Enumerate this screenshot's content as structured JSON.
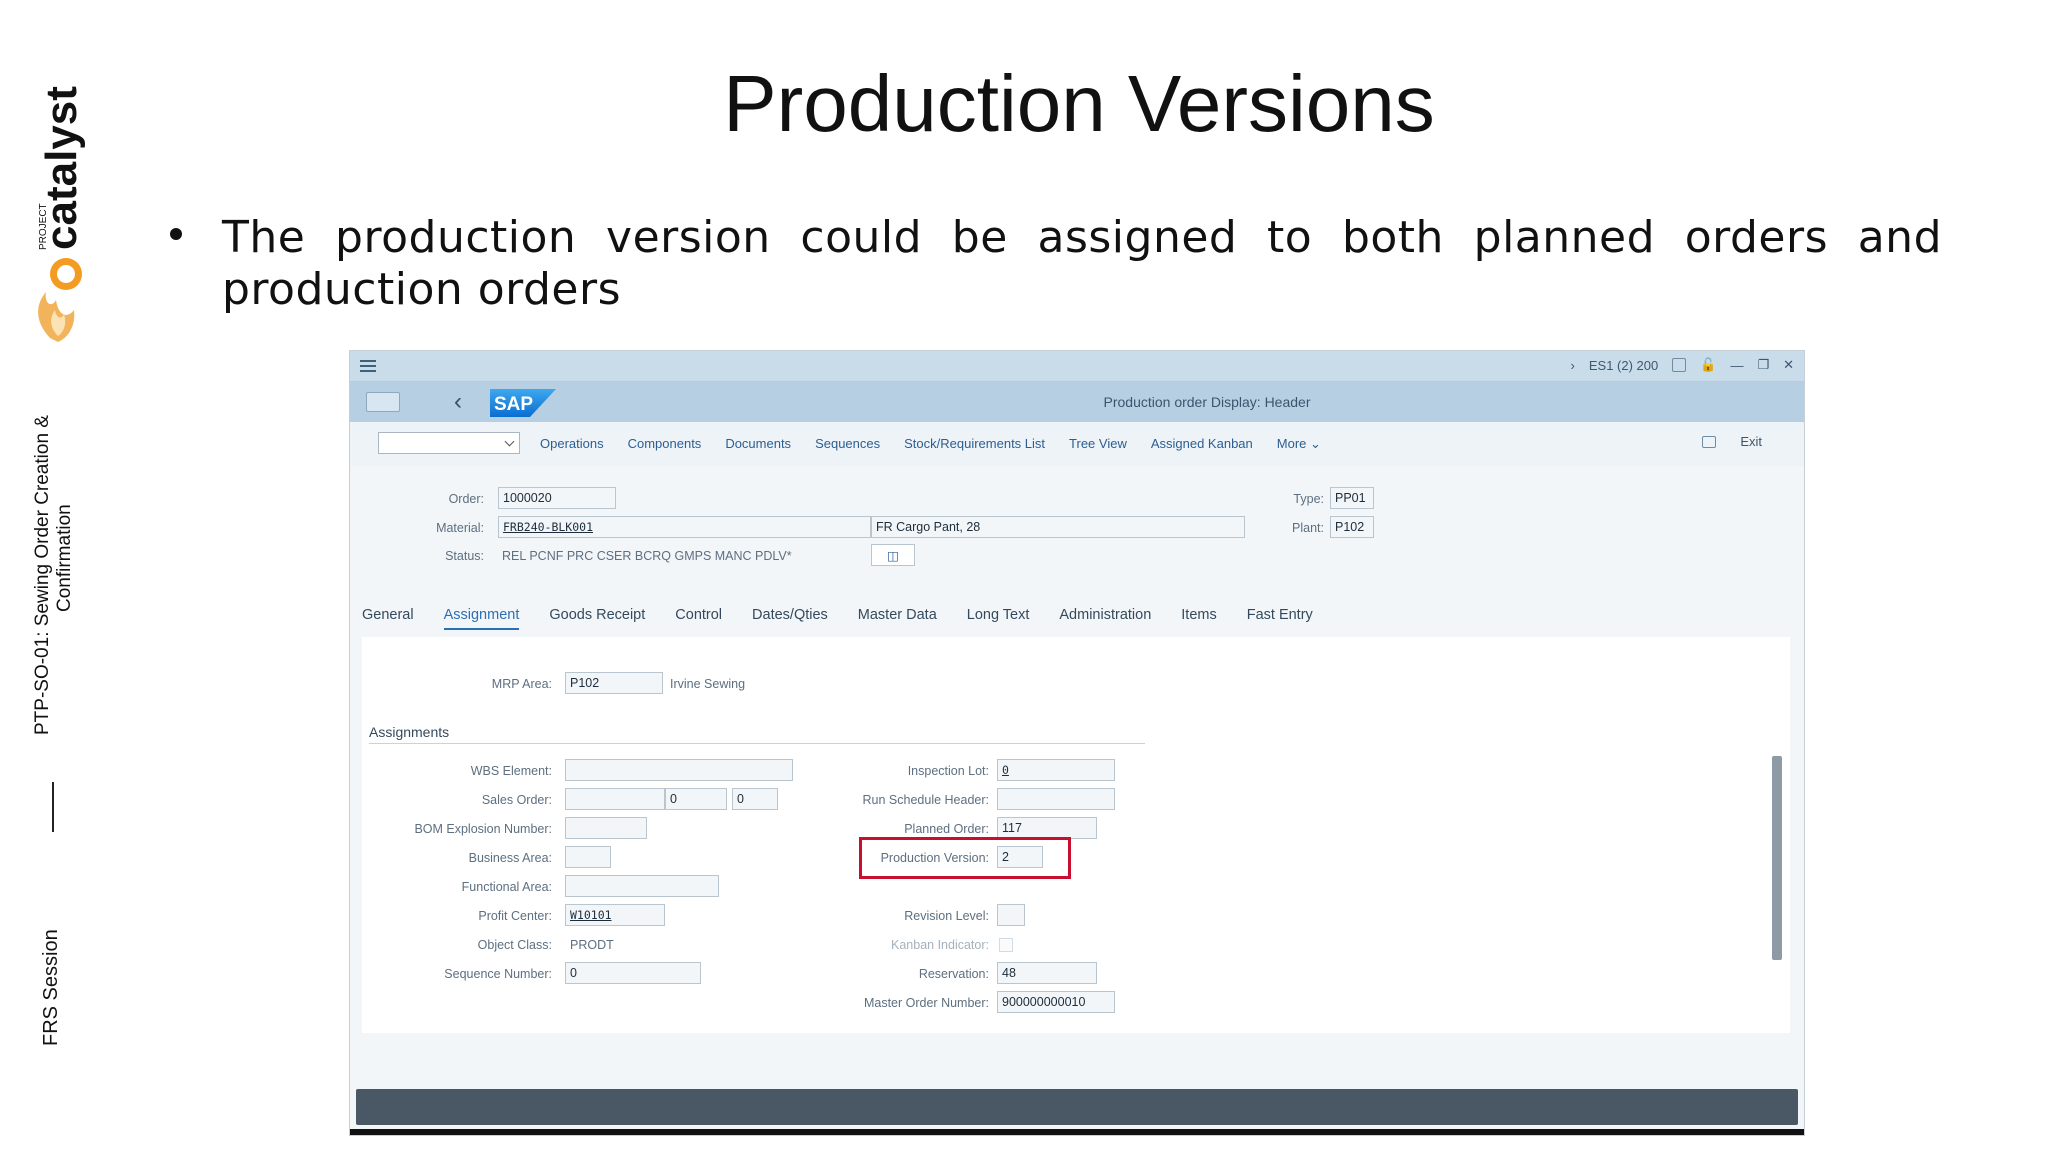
{
  "slide": {
    "title": "Production Versions",
    "bullet": "The production version could be assigned to both planned orders and production orders",
    "rail_text_top": "PTP-SO-01: Sewing Order Creation &",
    "rail_text_top2": "Confirmation",
    "rail_text_bottom": "FRS Session",
    "logo_small": "PROJECT",
    "logo_big": "catalyst"
  },
  "sap": {
    "system_info": "ES1 (2) 200",
    "logo_text": "SAP",
    "header_title": "Production order Display: Header",
    "toolbar_items": [
      "Operations",
      "Components",
      "Documents",
      "Sequences",
      "Stock/Requirements List",
      "Tree View",
      "Assigned Kanban",
      "More"
    ],
    "exit_label": "Exit",
    "header_fields": {
      "order_label": "Order:",
      "order_value": "1000020",
      "material_label": "Material:",
      "material_value": "FRB240-BLK001",
      "material_desc": "FR Cargo Pant, 28",
      "status_label": "Status:",
      "status_value": "REL  PCNF PRC  CSER BCRQ GMPS MANC PDLV*",
      "type_label": "Type:",
      "type_value": "PP01",
      "plant_label": "Plant:",
      "plant_value": "P102"
    },
    "tabs": [
      "General",
      "Assignment",
      "Goods Receipt",
      "Control",
      "Dates/Qties",
      "Master Data",
      "Long Text",
      "Administration",
      "Items",
      "Fast Entry"
    ],
    "active_tab": "Assignment",
    "mrp_area_label": "MRP Area:",
    "mrp_area_value": "P102",
    "mrp_area_desc": "Irvine Sewing",
    "assignments_title": "Assignments",
    "left": {
      "wbs_label": "WBS Element:",
      "sales_order_label": "Sales Order:",
      "sales_order_item": "0",
      "sales_order_sched": "0",
      "bom_label": "BOM Explosion Number:",
      "business_area_label": "Business Area:",
      "functional_area_label": "Functional Area:",
      "profit_center_label": "Profit Center:",
      "profit_center_value": "W10101",
      "object_class_label": "Object Class:",
      "object_class_value": "PRODT",
      "sequence_label": "Sequence Number:",
      "sequence_value": "0"
    },
    "right": {
      "inspection_label": "Inspection Lot:",
      "inspection_value": "0",
      "run_schedule_label": "Run Schedule Header:",
      "planned_order_label": "Planned Order:",
      "planned_order_value": "117",
      "production_version_label": "Production Version:",
      "production_version_value": "2",
      "revision_label": "Revision Level:",
      "kanban_label": "Kanban Indicator:",
      "reservation_label": "Reservation:",
      "reservation_value": "48",
      "master_order_label": "Master Order Number:",
      "master_order_value": "900000000010"
    },
    "colors": {
      "highlight": "#c8102e",
      "shell": "#b7cfe3",
      "link": "#2c5e93"
    }
  }
}
